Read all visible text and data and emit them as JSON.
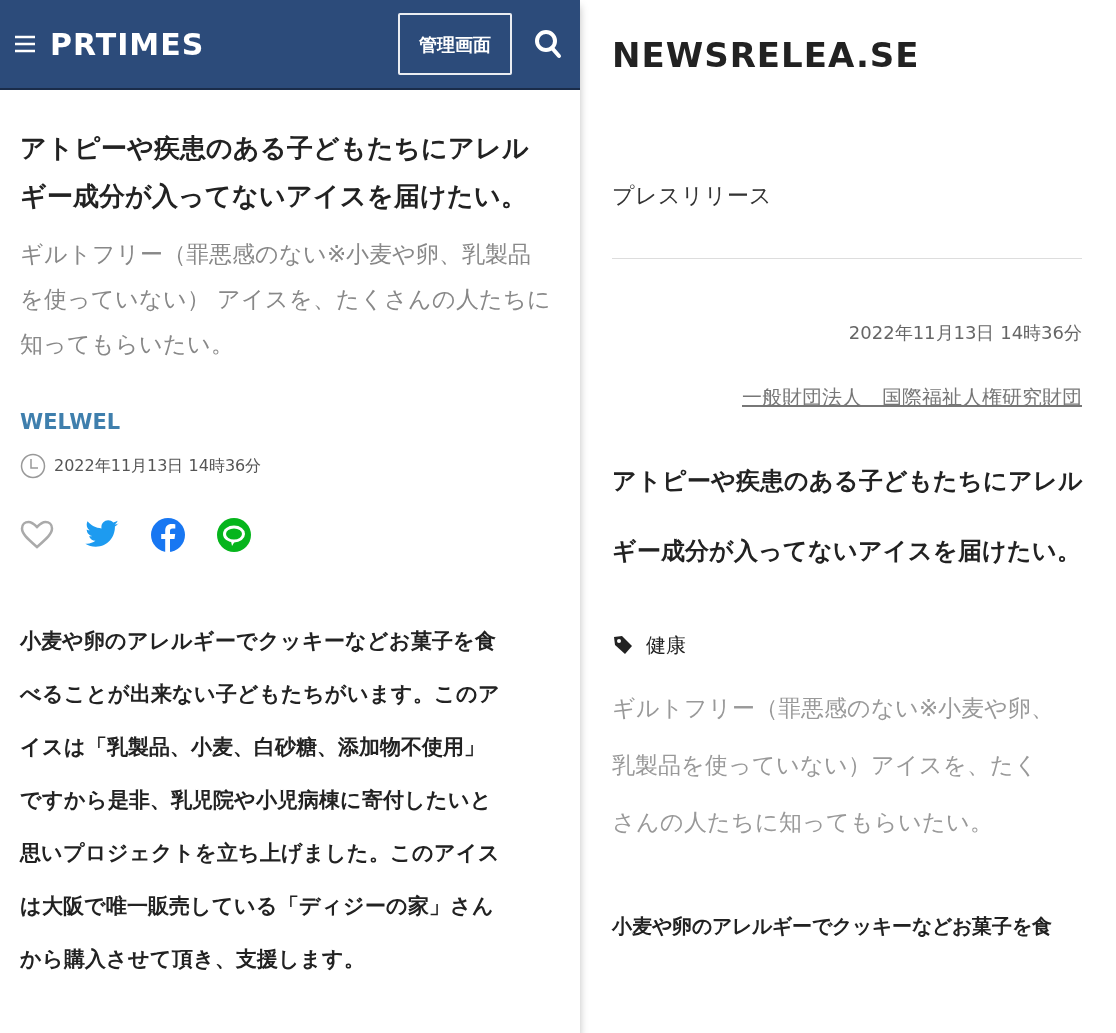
{
  "left": {
    "header": {
      "logo": "PRTIMES",
      "admin_button": "管理画面"
    },
    "title": "アトピーや疾患のある子どもたちにアレルギー成分が入ってないアイスを届けたい。",
    "subtitle": "ギルトフリー（罪悪感のない※小麦や卵、乳製品を使っていない） アイスを、たくさんの人たちに知ってもらいたい。",
    "company": "WELWEL",
    "date": "2022年11月13日 14時36分",
    "body": "小麦や卵のアレルギーでクッキーなどお菓子を食べることが出来ない子どもたちがいます。このアイスは「乳製品、小麦、白砂糖、添加物不使用」ですから是非、乳児院や小児病棟に寄付したいと思いプロジェクトを立ち上げました。このアイスは大阪で唯一販売している「ディジーの家」さんから購入させて頂き、支援します。"
  },
  "right": {
    "logo": "NEWSRELEA.SE",
    "category": "プレスリリース",
    "date": "2022年11月13日 14時36分",
    "organization": "一般財団法人　国際福祉人権研究財団",
    "title": "アトピーや疾患のある子どもたちにアレルギー成分が入ってないアイスを届けたい。",
    "tag": "健康",
    "subtitle": "ギルトフリー（罪悪感のない※小麦や卵、乳製品を使っていない）アイスを、たくさんの人たちに知ってもらいたい。",
    "body": "小麦や卵のアレルギーでクッキーなどお菓子を食"
  }
}
